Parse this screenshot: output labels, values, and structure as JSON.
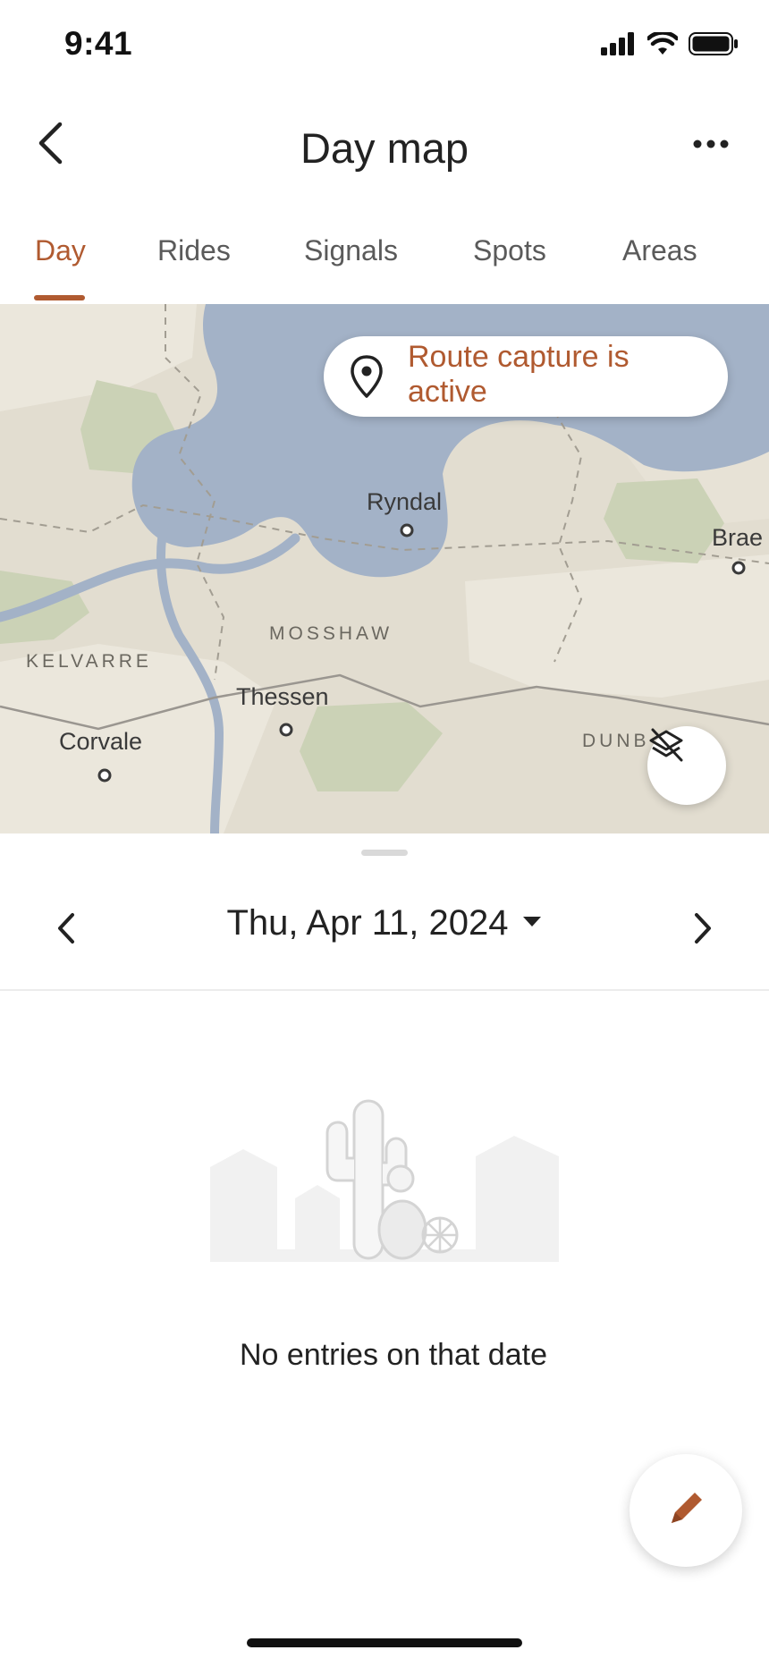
{
  "status_bar": {
    "time": "9:41",
    "icons": [
      "cellular-signal-icon",
      "wifi-icon",
      "battery-icon"
    ]
  },
  "header": {
    "title": "Day map",
    "back_icon": "chevron-left-icon",
    "more_icon": "more-horizontal-icon"
  },
  "tabs": [
    {
      "label": "Day",
      "active": true
    },
    {
      "label": "Rides",
      "active": false
    },
    {
      "label": "Signals",
      "active": false
    },
    {
      "label": "Spots",
      "active": false
    },
    {
      "label": "Areas",
      "active": false
    }
  ],
  "map": {
    "route_status": "Route capture is active",
    "places": [
      "Ryndal",
      "Brae",
      "Thessen",
      "Corvale"
    ],
    "districts": [
      "MOSSHAW",
      "KELVARRE",
      "DUNB"
    ],
    "layers_icon": "layers-off-icon",
    "colors": {
      "water": "#a3b2c7",
      "land": "#e2ddd0",
      "park": "#cbd2b6",
      "road": "#9a9690"
    }
  },
  "date_nav": {
    "date": "Thu, Apr 11, 2024",
    "prev_icon": "chevron-left-icon",
    "next_icon": "chevron-right-icon",
    "dropdown_icon": "caret-down-icon"
  },
  "empty_state": {
    "message": "No entries on that date",
    "illustration": "desert-cactus-illustration"
  },
  "fab": {
    "icon": "pencil-icon"
  },
  "accent_color": "#b05a30"
}
